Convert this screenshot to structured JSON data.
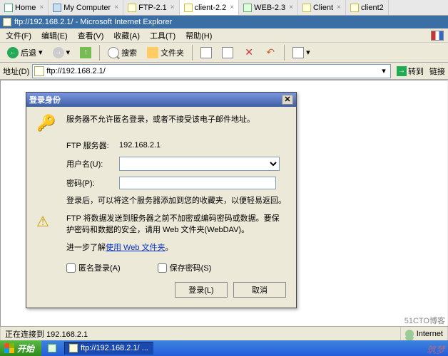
{
  "top_tabs": {
    "home": "Home",
    "mycomputer": "My Computer",
    "ftp21": "FTP-2.1",
    "client22": "client-2.2",
    "web23": "WEB-2.3",
    "client": "Client",
    "client2": "client2"
  },
  "title_bar": "ftp://192.168.2.1/ - Microsoft Internet Explorer",
  "menu": {
    "file": "文件(F)",
    "edit": "编辑(E)",
    "view": "查看(V)",
    "fav": "收藏(A)",
    "tool": "工具(T)",
    "help": "帮助(H)"
  },
  "toolbar": {
    "back": "后退",
    "search": "搜索",
    "folders": "文件夹"
  },
  "address": {
    "label": "地址(D)",
    "value": "ftp://192.168.2.1/",
    "go": "转到",
    "links": "链接"
  },
  "dialog": {
    "title": "登录身份",
    "msg_top": "服务器不允许匿名登录，或者不接受该电子邮件地址。",
    "server_label": "FTP 服务器:",
    "server_value": "192.168.2.1",
    "user_label": "用户名(U):",
    "pwd_label": "密码(P):",
    "info1": "登录后，可以将这个服务器添加到您的收藏夹，以便轻易返回。",
    "info2": "FTP 将数据发送到服务器之前不加密或编码密码或数据。要保护密码和数据的安全，请用 Web 文件夹(WebDAV)。",
    "link_prefix": "进一步了解",
    "link_text": "使用 Web 文件夹",
    "link_suffix": "。",
    "anon": "匿名登录(A)",
    "save": "保存密码(S)",
    "login_btn": "登录(L)",
    "cancel_btn": "取消"
  },
  "status": {
    "left": "正在连接到 192.168.2.1",
    "right": "Internet"
  },
  "taskbar": {
    "start": "开始",
    "task1": "ftp://192.168.2.1/ ..."
  },
  "watermark": "51CTO博客"
}
